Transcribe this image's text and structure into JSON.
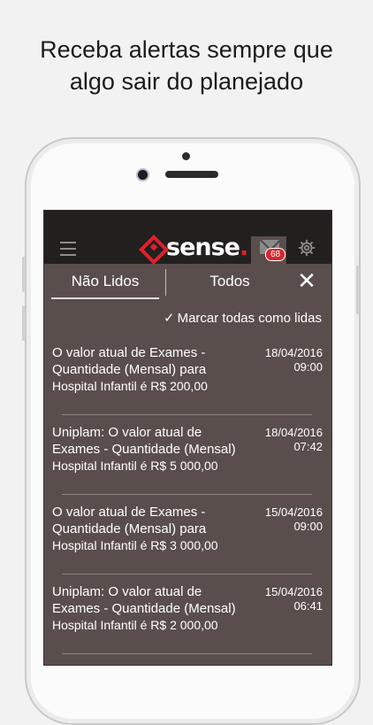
{
  "headline": {
    "line1": "Receba alertas sempre que",
    "line2": "algo sair do planejado"
  },
  "app": {
    "logo_text": "sense",
    "logo_dot": ".",
    "badge_count": "68",
    "brand_color": "#e0202b"
  },
  "tabs": {
    "unread_label": "Não Lidos",
    "all_label": "Todos",
    "close_glyph": "✕"
  },
  "mark_all": {
    "check": "✓",
    "label": "Marcar todas como lidas"
  },
  "notifications": [
    {
      "line1": "O valor atual de Exames -",
      "line2": "Quantidade (Mensal) para",
      "line3": "Hospital Infantil é R$ 200,00",
      "date": "18/04/2016",
      "time": "09:00"
    },
    {
      "line1": "Uniplam: O valor atual de",
      "line2": "Exames - Quantidade (Mensal)",
      "line3": "Hospital Infantil é R$ 5 000,00",
      "date": "18/04/2016",
      "time": "07:42"
    },
    {
      "line1": "O valor atual de Exames -",
      "line2": "Quantidade (Mensal) para",
      "line3": "Hospital Infantil é R$ 3 000,00",
      "date": "15/04/2016",
      "time": "09:00"
    },
    {
      "line1": "Uniplam: O valor atual de",
      "line2": "Exames - Quantidade (Mensal)",
      "line3": "Hospital Infantil é R$ 2 000,00",
      "date": "15/04/2016",
      "time": "06:41"
    }
  ]
}
